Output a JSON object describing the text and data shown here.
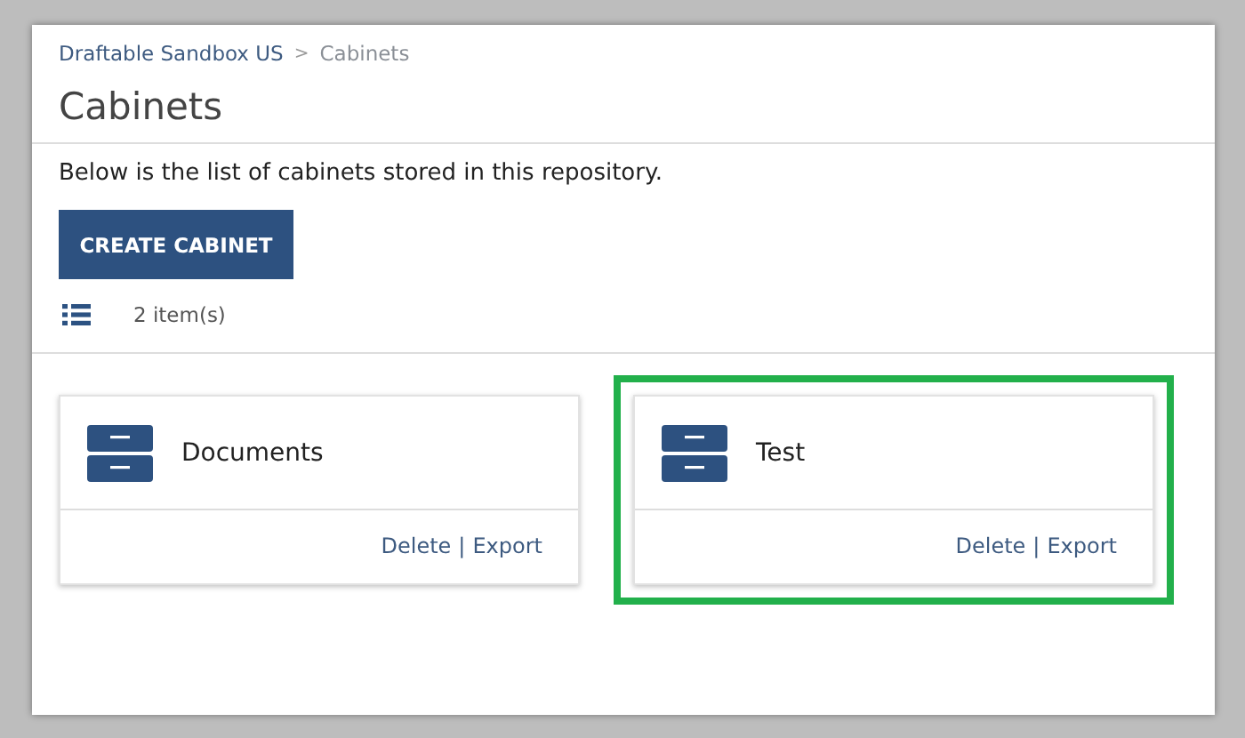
{
  "breadcrumb": [
    {
      "label": "Draftable Sandbox US",
      "current": false
    },
    {
      "label": "Cabinets",
      "current": true
    }
  ],
  "breadcrumb_separator": ">",
  "title": "Cabinets",
  "description": "Below is the list of cabinets stored in this repository.",
  "create_button": "CREATE CABINET",
  "item_count": "2 item(s)",
  "cabinets": [
    {
      "name": "Documents",
      "highlighted": false,
      "actions": [
        "Delete",
        "Export"
      ]
    },
    {
      "name": "Test",
      "highlighted": true,
      "actions": [
        "Delete",
        "Export"
      ]
    }
  ],
  "action_separator": "|"
}
